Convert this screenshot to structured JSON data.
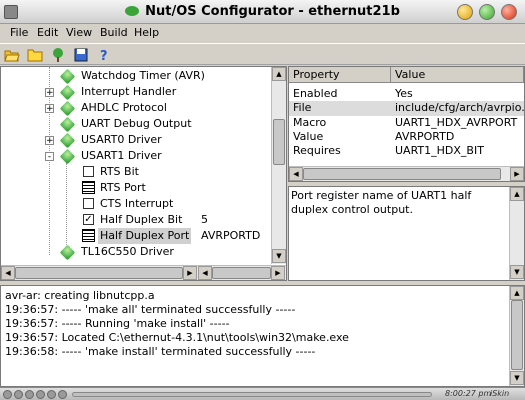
{
  "window": {
    "title": "Nut/OS Configurator - ethernut21b"
  },
  "menu": [
    "File",
    "Edit",
    "View",
    "Build",
    "Help"
  ],
  "toolbar": [
    "open-folder-icon",
    "folder-icon",
    "tree-icon",
    "save-icon",
    "help-icon"
  ],
  "tree": {
    "items": [
      {
        "label": "Watchdog Timer (AVR)",
        "icon": "module-icon",
        "expander": ""
      },
      {
        "label": "Interrupt Handler",
        "icon": "module-icon",
        "expander": "+"
      },
      {
        "label": "AHDLC Protocol",
        "icon": "module-icon",
        "expander": "+"
      },
      {
        "label": "UART Debug Output",
        "icon": "module-icon",
        "expander": ""
      },
      {
        "label": "USART0 Driver",
        "icon": "module-icon",
        "expander": "+"
      },
      {
        "label": "USART1 Driver",
        "icon": "module-icon",
        "expander": "-"
      },
      {
        "label": "RTS Bit",
        "icon": "checkbox",
        "checked": false
      },
      {
        "label": "RTS Port",
        "icon": "option-icon"
      },
      {
        "label": "CTS Interrupt",
        "icon": "checkbox",
        "checked": false
      },
      {
        "label": "Half Duplex Bit",
        "icon": "checkbox",
        "checked": true,
        "value": "5"
      },
      {
        "label": "Half Duplex Port",
        "icon": "option-icon",
        "value": "AVRPORTD",
        "selected": true
      },
      {
        "label": "TL16C550 Driver",
        "icon": "module-icon",
        "expander": ""
      }
    ]
  },
  "properties": {
    "headers": [
      "Property",
      "Value"
    ],
    "rows": [
      {
        "property": "Enabled",
        "value": "Yes"
      },
      {
        "property": "File",
        "value": "include/cfg/arch/avrpio.h"
      },
      {
        "property": "Macro",
        "value": "UART1_HDX_AVRPORT"
      },
      {
        "property": "Value",
        "value": "AVRPORTD"
      },
      {
        "property": "Requires",
        "value": "UART1_HDX_BIT"
      }
    ]
  },
  "description": "Port register name of UART1 half duplex control output.",
  "log": [
    "avr-ar: creating libnutcpp.a",
    "19:36:57: ----- 'make all' terminated successfully -----",
    "19:36:57: ----- Running 'make install' -----",
    "19:36:57: Located C:\\ethernut-4.3.1\\nut\\tools\\win32\\make.exe",
    "19:36:58: ----- 'make install' terminated successfully -----"
  ],
  "status": {
    "time": "8:00:27 pm",
    "brand": "iSkin"
  }
}
